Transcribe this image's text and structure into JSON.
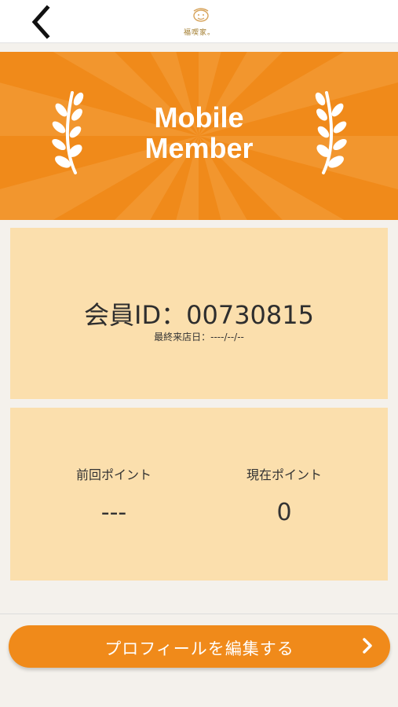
{
  "header": {
    "back_icon": "chevron-left-icon",
    "logo_text": "福喫家。"
  },
  "banner": {
    "title_line1": "Mobile",
    "title_line2": "Member",
    "colors": {
      "background": "#f08a1a",
      "rays": "#f5a040",
      "text": "#ffffff"
    },
    "icons": [
      "laurel-left-icon",
      "laurel-right-icon"
    ]
  },
  "member": {
    "id_label": "会員ID：",
    "id_value": "00730815",
    "last_visit_label": "最終来店日：",
    "last_visit_value": "----/--/--"
  },
  "points": {
    "previous_label": "前回ポイント",
    "previous_value": "---",
    "current_label": "現在ポイント",
    "current_value": "0"
  },
  "actions": {
    "edit_profile_label": "プロフィールを編集する",
    "edit_profile_icon": "chevron-right-icon",
    "accent_color": "#f08a1a"
  },
  "card_color": "#fbdfad"
}
